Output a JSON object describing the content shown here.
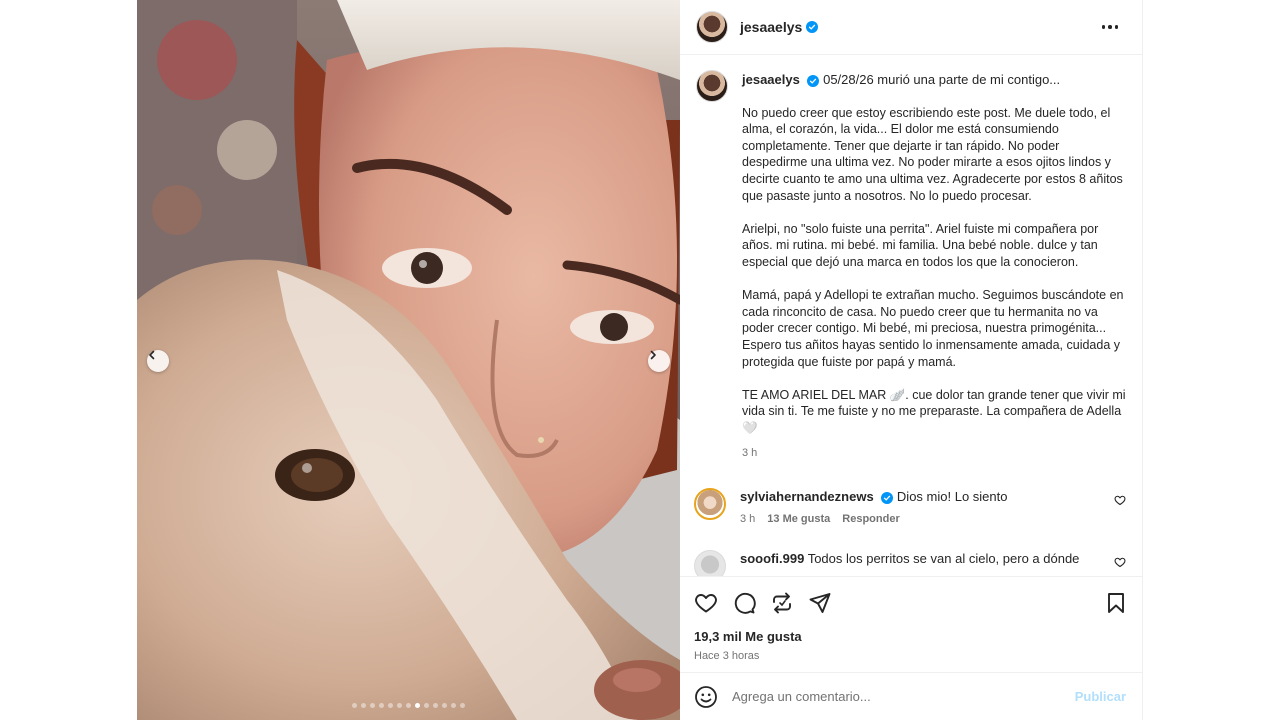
{
  "post": {
    "username": "jesaaelys",
    "carousel": {
      "total": 13,
      "active": 7
    }
  },
  "caption": {
    "username": "jesaaelys",
    "headline": "05/28/26 murió una parte de mi contigo...",
    "paragraphs": [
      "No puedo creer que estoy escribiendo este post. Me duele todo, el alma, el corazón, la vida... El dolor me está consumiendo completamente. Tener que dejarte ir tan rápido. No poder despedirme una ultima vez. No poder mirarte a esos ojitos lindos y decirte cuanto te amo una ultima vez. Agradecerte por estos 8 añitos que pasaste junto a nosotros. No lo puedo procesar.",
      "Arielpi, no \"solo fuiste una perrita\". Ariel fuiste mi compañera por años. mi rutina. mi bebé. mi familia. Una bebé noble. dulce y tan especial que dejó una marca en todos los que la conocieron.",
      "Mamá, papá y Adellopi te extrañan mucho. Seguimos buscándote en cada rinconcito de casa. No puedo creer que tu hermanita no va poder crecer contigo. Mi bebé, mi preciosa, nuestra primogénita... Espero tus añitos hayas sentido lo inmensamente amada, cuidada y protegida que fuiste por papá y mamá.",
      "TE AMO ARIEL DEL MAR 🪽. cue dolor tan grande tener que vivir mi vida sin ti. Te me fuiste y no me preparaste. La compañera de Adella 🤍"
    ],
    "time": "3 h"
  },
  "comments": [
    {
      "username": "sylviahernandeznews",
      "text": "Dios mio! Lo siento",
      "time": "3 h",
      "likes": "13 Me gusta",
      "reply": "Responder"
    },
    {
      "username": "sooofi.999",
      "text": "Todos los perritos se van al cielo, pero a dónde"
    }
  ],
  "stats": {
    "likes": "19,3 mil Me gusta",
    "posted": "Hace 3 horas"
  },
  "composer": {
    "placeholder": "Agrega un comentario...",
    "publish": "Publicar"
  },
  "colors": {
    "verified": "#0095f6",
    "publish_disabled": "#b2dffc",
    "muted": "#737373"
  }
}
